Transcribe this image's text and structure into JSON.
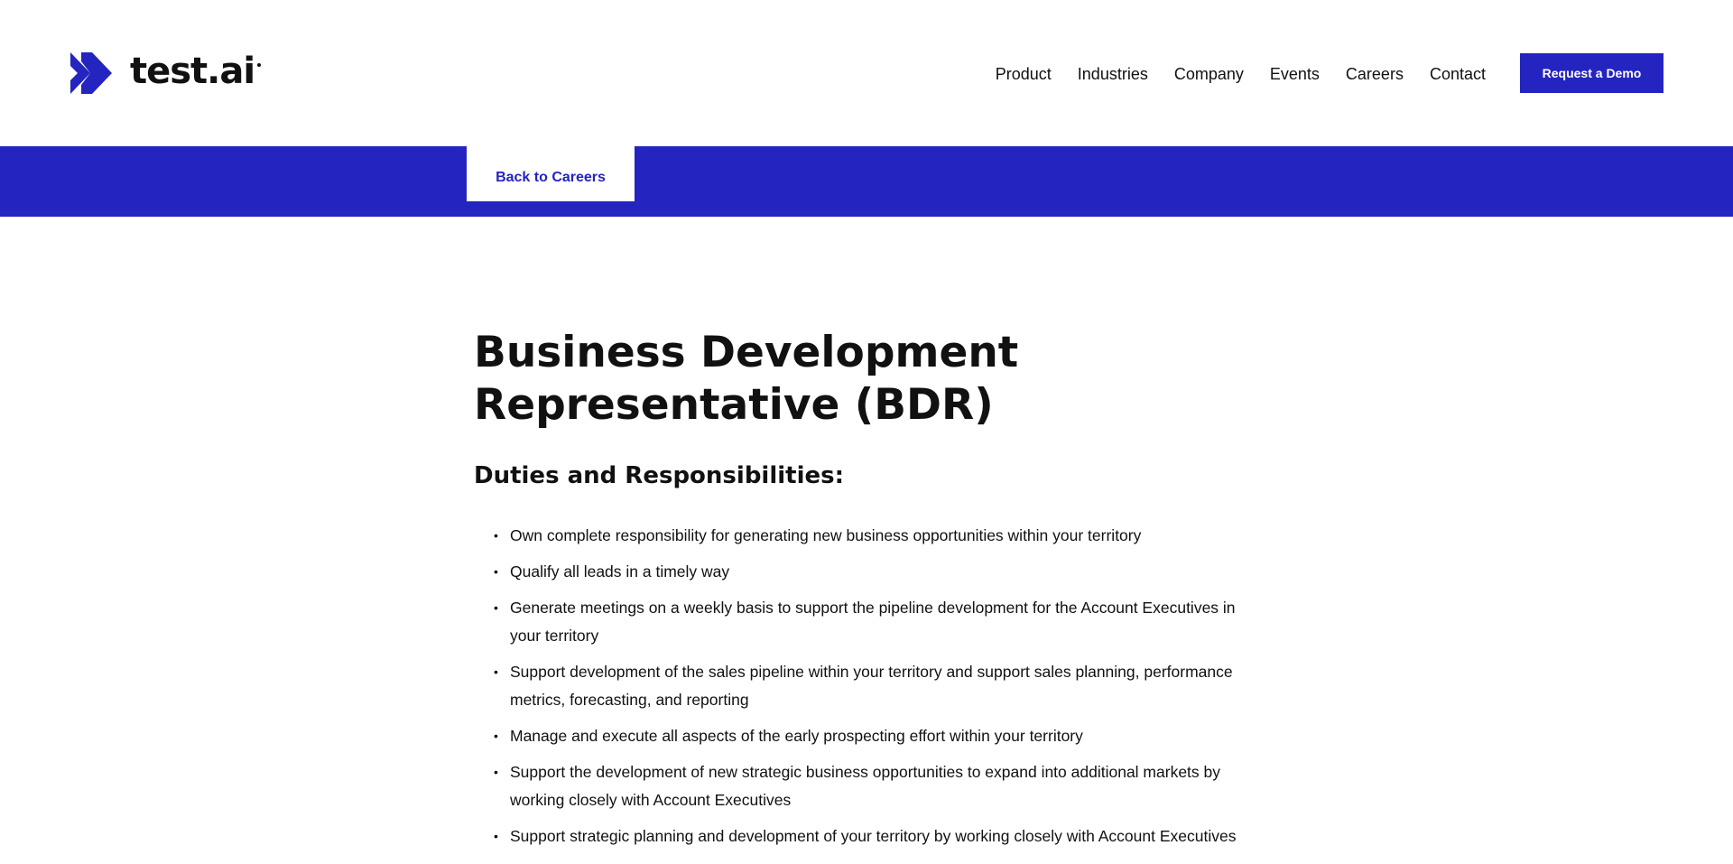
{
  "brand": {
    "name": "test.ai",
    "color": "#2424c0"
  },
  "nav": {
    "items": [
      "Product",
      "Industries",
      "Company",
      "Events",
      "Careers",
      "Contact"
    ],
    "cta_label": "Request a Demo"
  },
  "banner": {
    "back_label": "Back to Careers"
  },
  "job": {
    "title_line1": "Business Development",
    "title_line2": "Representative (BDR)",
    "section_heading": "Duties and Responsibilities:",
    "duties": [
      "Own complete responsibility for generating new business opportunities within your territory",
      "Qualify all leads in a timely way",
      "Generate meetings on a weekly basis to support the pipeline development for the Account Executives in your territory",
      "Support development of the sales pipeline within your territory and support sales planning, performance metrics, forecasting, and reporting",
      "Manage and execute all aspects of the early prospecting effort within your territory",
      "Support the development of new strategic business opportunities to expand into additional markets by working closely with Account Executives",
      "Support strategic planning and development of your territory by working closely with Account Executives"
    ]
  }
}
